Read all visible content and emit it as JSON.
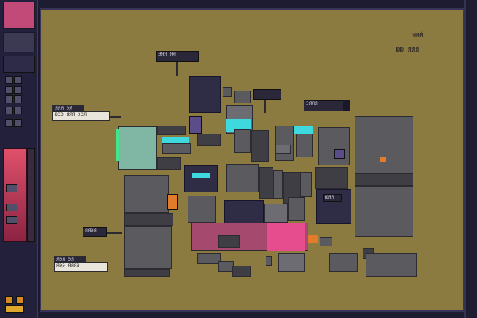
{
  "map": {
    "corner_title": "ЯØЙ",
    "corner_subtitle": "ЮЮ ЯЯЯ",
    "label_upper": "ЮЭЭ ЯЯЯ ЭЭЯ",
    "label_upper_header": "ЯЯЯ ЭЯ",
    "label_lower": "ЯЭЭ ЯЯЯЭ",
    "label_lower_header": "ЯЭЯ ЭЯ",
    "tag_top": "ЭЯЯ ЯЯ",
    "tag_middle": "ЯЯЭЯ",
    "tag_right_console": "ЭЯЯЯ",
    "tag_console_screen": "ЮЯЯ"
  },
  "colors": {
    "background": "#8c7b40",
    "accent_cyan": "#3ed8df",
    "accent_magenta": "#e64d8e",
    "accent_orange": "#e27b2a",
    "panel": "#22203a"
  },
  "icons": [
    "portrait-icon",
    "inventory-icon",
    "map-icon",
    "settings-icon"
  ]
}
